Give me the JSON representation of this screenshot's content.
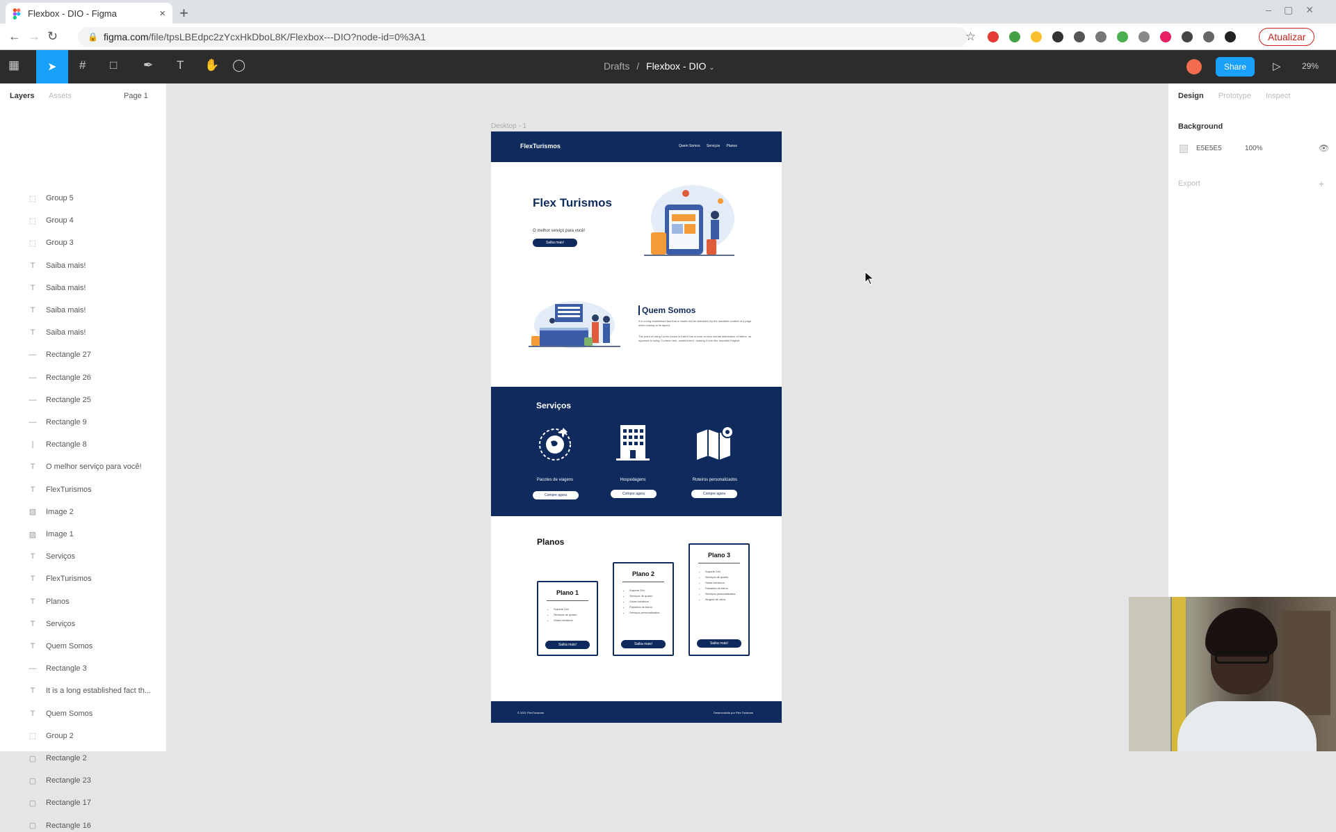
{
  "browser": {
    "tab_title": "Flexbox - DIO - Figma",
    "tab_close": "×",
    "new_tab": "+",
    "url_host": "figma.com",
    "url_path": "/file/tpsLBEdpc2zYcxHkDboL8K/Flexbox---DIO?node-id=0%3A1",
    "update_button": "Atualizar",
    "ext_colors": [
      "#e53935",
      "#43a047",
      "#fbc02d",
      "#333333",
      "#555555",
      "#777777",
      "#4caf50",
      "#888888",
      "#e91e63",
      "#444444",
      "#666666",
      "#222222"
    ]
  },
  "figma": {
    "breadcrumb_drafts": "Drafts",
    "breadcrumb_sep": "/",
    "file_name": "Flexbox - DIO",
    "share": "Share",
    "zoom": "29%",
    "accent": "#18a0fb"
  },
  "layers_panel": {
    "tab_layers": "Layers",
    "tab_assets": "Assets",
    "page": "Page 1",
    "items": [
      {
        "icon": "group",
        "label": "Group 5"
      },
      {
        "icon": "group",
        "label": "Group 4"
      },
      {
        "icon": "group",
        "label": "Group 3"
      },
      {
        "icon": "text",
        "label": "Saiba mais!"
      },
      {
        "icon": "text",
        "label": "Saiba mais!"
      },
      {
        "icon": "text",
        "label": "Saiba mais!"
      },
      {
        "icon": "text",
        "label": "Saiba mais!"
      },
      {
        "icon": "line",
        "label": "Rectangle 27"
      },
      {
        "icon": "line",
        "label": "Rectangle 26"
      },
      {
        "icon": "line",
        "label": "Rectangle 25"
      },
      {
        "icon": "line",
        "label": "Rectangle 9"
      },
      {
        "icon": "vline",
        "label": "Rectangle 8"
      },
      {
        "icon": "text",
        "label": "O melhor serviço para você!"
      },
      {
        "icon": "text",
        "label": "FlexTurismos"
      },
      {
        "icon": "image",
        "label": "Image 2"
      },
      {
        "icon": "image",
        "label": "Image 1"
      },
      {
        "icon": "text",
        "label": "Serviços"
      },
      {
        "icon": "text",
        "label": "FlexTurismos"
      },
      {
        "icon": "text",
        "label": "Planos"
      },
      {
        "icon": "text",
        "label": "Serviços"
      },
      {
        "icon": "text",
        "label": "Quem Somos"
      },
      {
        "icon": "line",
        "label": "Rectangle 3"
      },
      {
        "icon": "text",
        "label": "It is a long established fact th..."
      },
      {
        "icon": "text",
        "label": "Quem Somos"
      },
      {
        "icon": "group",
        "label": "Group 2"
      },
      {
        "icon": "rect",
        "label": "Rectangle 2"
      },
      {
        "icon": "rect",
        "label": "Rectangle 23"
      },
      {
        "icon": "rect",
        "label": "Rectangle 17"
      },
      {
        "icon": "rect",
        "label": "Rectangle 16"
      }
    ]
  },
  "canvas": {
    "frame_label": "Desktop - 1",
    "site": {
      "navy": "#0f2a5c",
      "logo": "FlexTurismos",
      "nav_links": [
        "Quem Somos",
        "Serviços",
        "Planos"
      ],
      "hero_title": "Flex Turismos",
      "hero_sub": "O melhor serviço para você!",
      "hero_button": "Saiba mais!",
      "quem_title": "Quem Somos",
      "quem_para1": "It is a long established fact that a reader will be distracted by the readable content of a page when looking at its layout.",
      "quem_para2": "The point of using Lorem Ipsum is that it has a more-or-less normal distribution of letters, as opposed to using 'Content here, content here', making it look like readable English.",
      "servicos_title": "Serviços",
      "services": [
        {
          "label": "Pacotes de viagens",
          "button": "Compre agora"
        },
        {
          "label": "Hospedagens",
          "button": "Compre agora"
        },
        {
          "label": "Roteiros personalizados",
          "button": "Compre agora"
        }
      ],
      "planos_title": "Planos",
      "plans": [
        {
          "name": "Plano 1",
          "items": [
            "Suporte 24h",
            "Serviços de quarto",
            "Guias turísticos"
          ],
          "button": "Saiba mais!"
        },
        {
          "name": "Plano 2",
          "items": [
            "Suporte 24h",
            "Serviços de quarto",
            "Guias turísticos",
            "Passeios de barco",
            "Serviços personalizados"
          ],
          "button": "Saiba mais!"
        },
        {
          "name": "Plano 3",
          "items": [
            "Suporte 24h",
            "Serviços de quarto",
            "Guias turísticos",
            "Passeios de barco",
            "Serviços personalizados",
            "Aluguel de carro"
          ],
          "button": "Saiba mais!"
        }
      ],
      "footer_left": "© 2021 FlexTurismos",
      "footer_right": "Desenvolvido por Flex Turismos"
    }
  },
  "design_panel": {
    "tab_design": "Design",
    "tab_prototype": "Prototype",
    "tab_inspect": "Inspect",
    "background_title": "Background",
    "bg_hex": "E5E5E5",
    "bg_opacity": "100%",
    "export": "Export",
    "export_plus": "+"
  }
}
